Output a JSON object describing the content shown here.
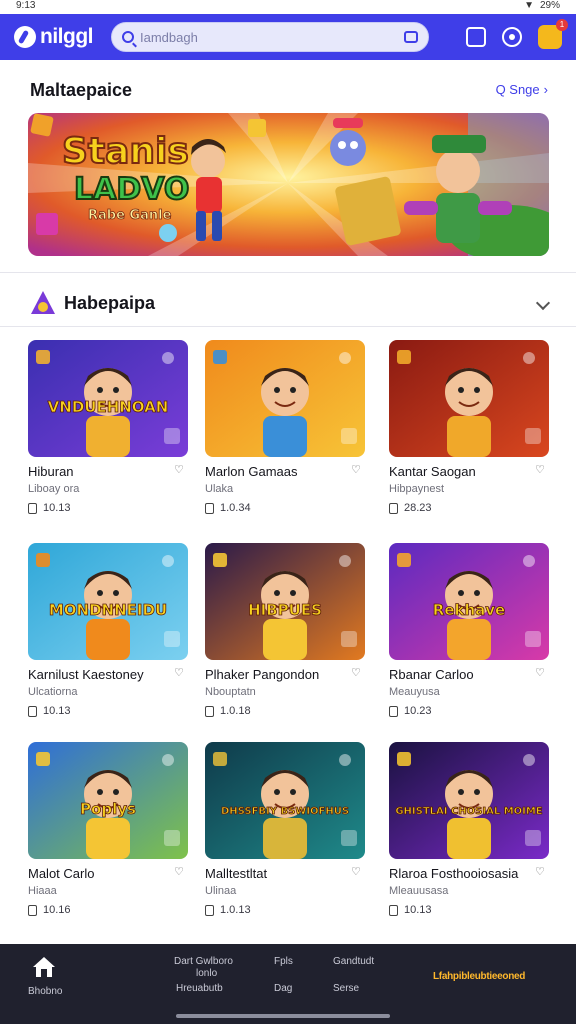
{
  "status": {
    "time": "9:13",
    "battery": "29%"
  },
  "header": {
    "logo_text": "nilggl",
    "search_placeholder": "Iamdbagh",
    "notification_count": "1"
  },
  "featured": {
    "title": "Maltaepaice",
    "see_all": "Q Snge",
    "banner_headline_1": "Stanis",
    "banner_headline_2": "LADVO",
    "banner_sub": "Rabe Ganle"
  },
  "category": {
    "title": "Habepaipa"
  },
  "games": [
    {
      "title": "Hiburan",
      "subtitle": "Liboay ora",
      "meta": "10.13",
      "thumb_text": "VNDUEHNOAN",
      "colors": [
        "#3a2fb0",
        "#7a3dd8",
        "#f0b030"
      ]
    },
    {
      "title": "Marlon Gamaas",
      "subtitle": "Ulaka",
      "meta": "1.0.34",
      "thumb_text": "",
      "colors": [
        "#f08a1c",
        "#f7c437",
        "#3a8fd8"
      ]
    },
    {
      "title": "Kantar Saogan",
      "subtitle": "Hibpaynest",
      "meta": "28.23",
      "thumb_text": "",
      "colors": [
        "#8a1a12",
        "#d9471f",
        "#f0a82a"
      ]
    },
    {
      "title": "Karnilust Kaestoney",
      "subtitle": "Ulcatiorna",
      "meta": "10.13",
      "thumb_text": "MONDNNEIDU",
      "colors": [
        "#2fa7d8",
        "#7cd0f0",
        "#f08a1c"
      ]
    },
    {
      "title": "Plhaker Pangondon",
      "subtitle": "Nbouptatn",
      "meta": "1.0.18",
      "thumb_text": "HIBPUES",
      "colors": [
        "#2a1a4a",
        "#e27a20",
        "#f4c534"
      ]
    },
    {
      "title": "Rbanar Carloo",
      "subtitle": "Meauyusa",
      "meta": "10.23",
      "thumb_text": "Rekhave",
      "colors": [
        "#5b2ac0",
        "#d83aa8",
        "#f3a52c"
      ]
    },
    {
      "title": "Malot Carlo",
      "subtitle": "Hiaaa",
      "meta": "10.16",
      "thumb_text": "Poplys",
      "colors": [
        "#2f6ed8",
        "#7fc24a",
        "#f4c534"
      ]
    },
    {
      "title": "Malltestltat",
      "subtitle": "Ulinaa",
      "meta": "1.0.13",
      "thumb_text": "DHSSFBIY BSWIOFHUS",
      "colors": [
        "#0f3a4a",
        "#1f8a8a",
        "#d8b53a"
      ]
    },
    {
      "title": "Rlaroa Fosthooiosasia",
      "subtitle": "Mleauusasa",
      "meta": "10.13",
      "thumb_text": "GHISTLAI CHOSIAL MOIME",
      "colors": [
        "#1a1240",
        "#7a2ac8",
        "#f0c030"
      ]
    }
  ],
  "bottom_nav": {
    "home_label": "Bhobno",
    "col1_top": "Dart Gwlboro",
    "col1_mid": "lonlo",
    "col1_bottom": "Hreuabutb",
    "col2_top": "Fpls",
    "col2_bottom": "Dag",
    "col3_top": "Gandtudt",
    "col3_bottom": "Serse",
    "brand": "Lfahpibleubtieeoned"
  }
}
